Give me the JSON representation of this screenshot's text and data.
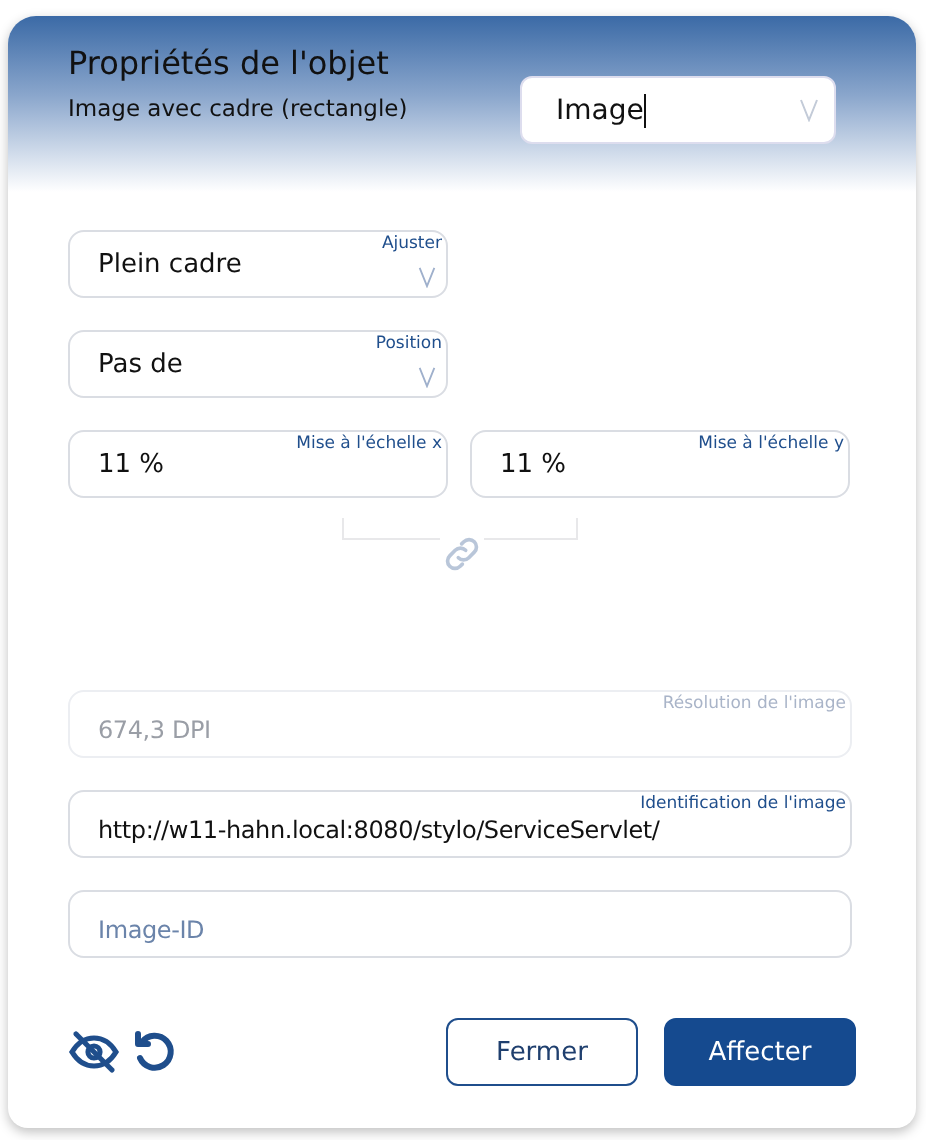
{
  "header": {
    "title": "Propriétés de l'objet",
    "subtitle": "Image avec cadre (rectangle)",
    "type_select": {
      "value": "Image"
    }
  },
  "rows": [
    {
      "fields": [
        {
          "kind": "dropdown",
          "label": "Ajuster",
          "value": "Plein cadre",
          "disabled": false
        }
      ]
    },
    {
      "fields": [
        {
          "kind": "dropdown",
          "label": "Position",
          "value": "Pas de",
          "disabled": false
        }
      ]
    },
    {
      "fields": [
        {
          "kind": "text",
          "label": "Mise à l'échelle x",
          "value": "11 %",
          "disabled": false
        },
        {
          "kind": "text",
          "label": "Mise à l'échelle y",
          "value": "11 %",
          "disabled": false
        }
      ]
    }
  ],
  "more_fields": [
    {
      "kind": "text",
      "label": "Résolution de l'image",
      "value": "674,3 DPI",
      "disabled": true
    },
    {
      "kind": "text",
      "label": "Identification de l'image",
      "value": "http://w11-hahn.local:8080/stylo/ServiceServlet/",
      "disabled": false
    },
    {
      "kind": "text",
      "placeholder": "Image-ID",
      "disabled": false
    }
  ],
  "buttons": [
    {
      "label": "Fermer",
      "kind": "secondary"
    },
    {
      "label": "Affecter",
      "kind": "primary"
    }
  ]
}
